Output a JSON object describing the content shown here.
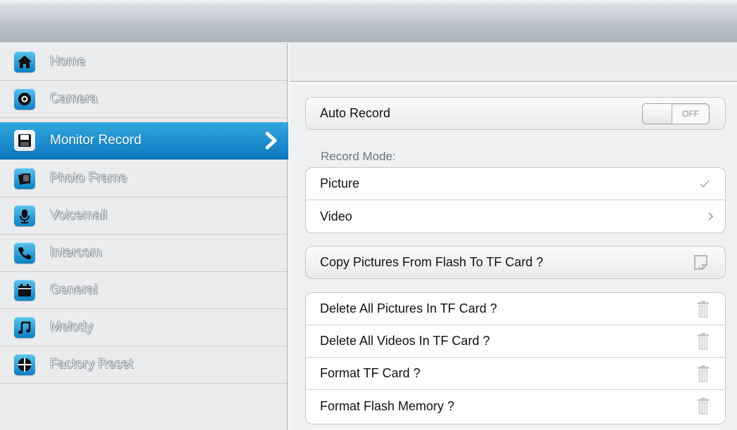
{
  "sidebar": {
    "items": [
      {
        "label": "Home",
        "icon": "home-icon"
      },
      {
        "label": "Camera",
        "icon": "camera-icon"
      },
      {
        "label": "Monitor Record",
        "icon": "floppy-disk-icon",
        "active": true
      },
      {
        "label": "Photo Frame",
        "icon": "photo-frame-icon"
      },
      {
        "label": "Voicemail",
        "icon": "microphone-icon"
      },
      {
        "label": "Intercom",
        "icon": "phone-icon"
      },
      {
        "label": "General",
        "icon": "calendar-icon"
      },
      {
        "label": "Melody",
        "icon": "music-note-icon"
      },
      {
        "label": "Factory Reset",
        "icon": "reset-icon"
      }
    ]
  },
  "settings": {
    "auto_record": {
      "label": "Auto Record",
      "state": "OFF"
    },
    "record_mode_label": "Record Mode:",
    "record_mode_options": [
      {
        "label": "Picture",
        "selected": true
      },
      {
        "label": "Video",
        "selected": false
      }
    ],
    "copy_pictures": {
      "label": "Copy Pictures From Flash To TF Card ?"
    },
    "delete_actions": [
      {
        "label": "Delete All Pictures In TF Card ?"
      },
      {
        "label": "Delete All Videos In TF Card ?"
      },
      {
        "label": "Format TF Card ?"
      },
      {
        "label": "Format Flash Memory ?"
      }
    ]
  },
  "colors": {
    "accent": "#1a8fd3",
    "icon_blue": "#0b80c4"
  }
}
